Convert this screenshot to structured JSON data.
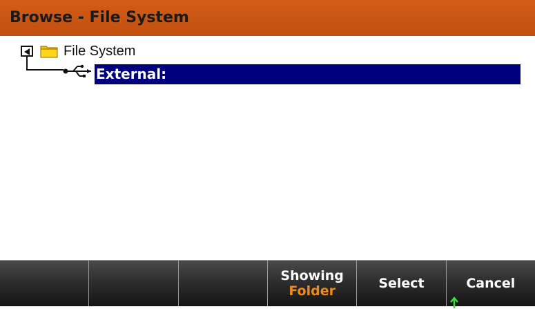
{
  "window": {
    "title": "Browse - File System"
  },
  "tree": {
    "root": {
      "label": "File System",
      "icon": "folder-icon"
    },
    "children": [
      {
        "label": "External:",
        "icon": "usb-icon",
        "selected": true
      }
    ]
  },
  "softkeys": [
    {
      "label": "",
      "sub": ""
    },
    {
      "label": "",
      "sub": ""
    },
    {
      "label": "",
      "sub": ""
    },
    {
      "label": "Showing",
      "sub": "Folder"
    },
    {
      "label": "Select",
      "sub": ""
    },
    {
      "label": "Cancel",
      "sub": ""
    }
  ],
  "colors": {
    "titlebar": "#c95514",
    "selection": "#00007f",
    "softkey_sub": "#f08a1e",
    "up_arrow": "#3cdc3c"
  }
}
